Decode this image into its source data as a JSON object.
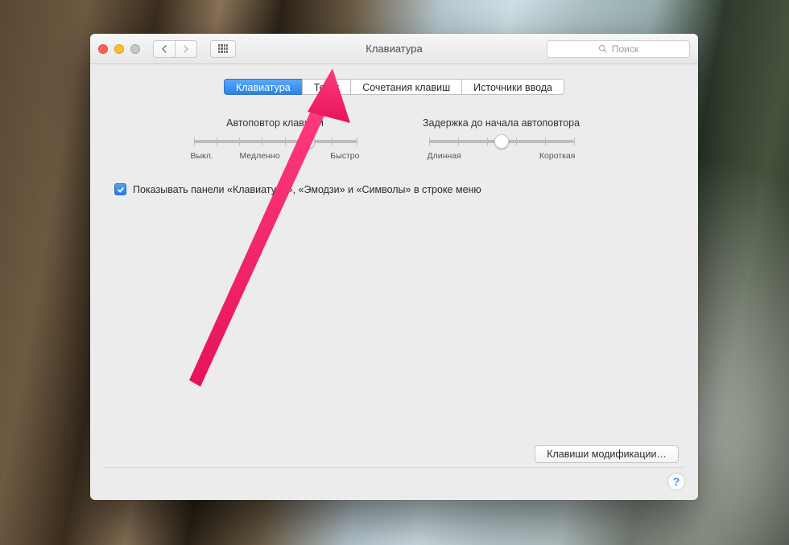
{
  "window": {
    "title": "Клавиатура"
  },
  "search": {
    "placeholder": "Поиск"
  },
  "tabs": [
    {
      "label": "Клавиатура",
      "active": true
    },
    {
      "label": "Текст",
      "active": false
    },
    {
      "label": "Сочетания клавиш",
      "active": false
    },
    {
      "label": "Источники ввода",
      "active": false
    }
  ],
  "slider_repeat": {
    "label": "Автоповтор клавиши",
    "min_label": "Выкл.",
    "mid_label": "Медленно",
    "max_label": "Быстро",
    "value_pct": 70
  },
  "slider_delay": {
    "label": "Задержка до начала автоповтора",
    "min_label": "Длинная",
    "max_label": "Короткая",
    "value_pct": 50
  },
  "checkbox_menu": {
    "checked": true,
    "label": "Показывать панели «Клавиатура», «Эмодзи» и «Символы» в строке меню"
  },
  "buttons": {
    "modifier_keys": "Клавиши модификации…"
  },
  "help_glyph": "?"
}
